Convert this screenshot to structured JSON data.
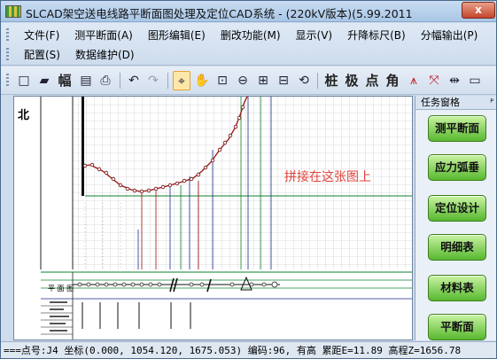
{
  "window": {
    "title": "SLCAD架空送电线路平断面图处理及定位CAD系统 - (220kV版本)(5.99.2011",
    "close_label": "x"
  },
  "menus": {
    "row1": [
      "文件(F)",
      "测平断面(A)",
      "图形编辑(E)",
      "删改功能(M)",
      "显示(V)",
      "升降标尺(B)",
      "分幅输出(P)"
    ],
    "row2": [
      "配置(S)",
      "数据维护(D)"
    ]
  },
  "toolbar": {
    "text_tools": [
      "幅",
      "桩",
      "极",
      "点",
      "角"
    ]
  },
  "canvas": {
    "north_label": "北",
    "overlay_text": "拼接在这张图上",
    "plan_label": "平 面 图"
  },
  "taskpane": {
    "title": "任务窗格",
    "buttons": [
      "测平断面",
      "应力弧垂",
      "定位设计",
      "明细表",
      "材料表",
      "平断面"
    ]
  },
  "status": {
    "text": "===点号:J4 坐标(0.000, 1054.120, 1675.053) 编码:96, 有高 累距E=11.89 高程Z=1656.78"
  },
  "colors": {
    "profile_line": "#a01010",
    "green_line": "#108030",
    "blue_line": "#1a2a8a",
    "overlay_red": "#e0423a",
    "task_button": "#58b830"
  }
}
